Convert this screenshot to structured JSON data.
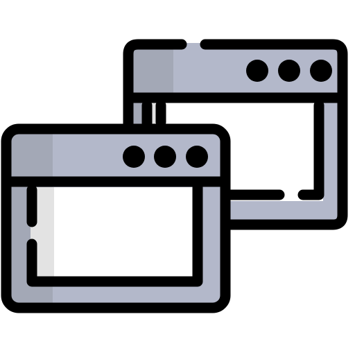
{
  "icon": {
    "semantic": "multiple-browser-windows-icon",
    "colors": {
      "outline": "#000000",
      "frame_light": "#b3b8ca",
      "frame_shade": "#a3a8b6",
      "frame_shade_dark": "#8d92a0",
      "content": "#ffffff",
      "content_shadow": "#e3e3e3"
    }
  }
}
